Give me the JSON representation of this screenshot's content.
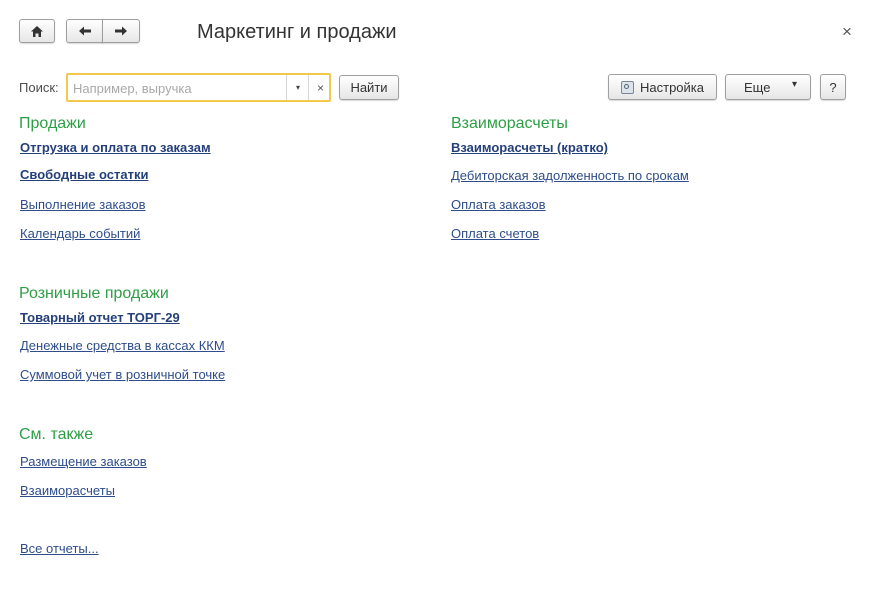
{
  "window": {
    "title": "Маркетинг и продажи",
    "close_glyph": "×"
  },
  "nav": {
    "home_icon": "⌂",
    "back_icon": "🡐",
    "forward_icon": "🡒"
  },
  "search": {
    "label": "Поиск:",
    "placeholder": "Например, выручка",
    "value": "",
    "dropdown_glyph": "▾",
    "clear_glyph": "×",
    "find_label": "Найти"
  },
  "toolbar": {
    "settings_label": "Настройка",
    "more_label": "Еще",
    "more_glyph": "▾",
    "help_label": "?"
  },
  "sections": {
    "sales": {
      "title": "Продажи",
      "items": [
        {
          "label": "Отгрузка и оплата по заказам",
          "important": true
        },
        {
          "label": "Свободные остатки",
          "important": true
        },
        {
          "label": "Выполнение заказов",
          "important": false
        },
        {
          "label": "Календарь событий",
          "important": false
        }
      ]
    },
    "retail": {
      "title": "Розничные продажи",
      "items": [
        {
          "label": "Товарный отчет ТОРГ-29",
          "important": true
        },
        {
          "label": "Денежные средства в кассах ККМ",
          "important": false
        },
        {
          "label": "Суммовой учет в розничной точке",
          "important": false
        }
      ]
    },
    "see_also": {
      "title": "См. также",
      "items": [
        {
          "label": "Размещение заказов",
          "important": false
        },
        {
          "label": "Взаиморасчеты",
          "important": false
        }
      ]
    },
    "settlements": {
      "title": "Взаиморасчеты",
      "items": [
        {
          "label": "Взаиморасчеты (кратко)",
          "important": true
        },
        {
          "label": "Дебиторская задолженность по срокам",
          "important": false
        },
        {
          "label": "Оплата заказов",
          "important": false
        },
        {
          "label": "Оплата счетов",
          "important": false
        }
      ]
    }
  },
  "all_reports_label": "Все отчеты...",
  "colors": {
    "section_title": "#2e9e46",
    "link": "#2f4d8a",
    "search_focus_border": "#f2c94c"
  }
}
